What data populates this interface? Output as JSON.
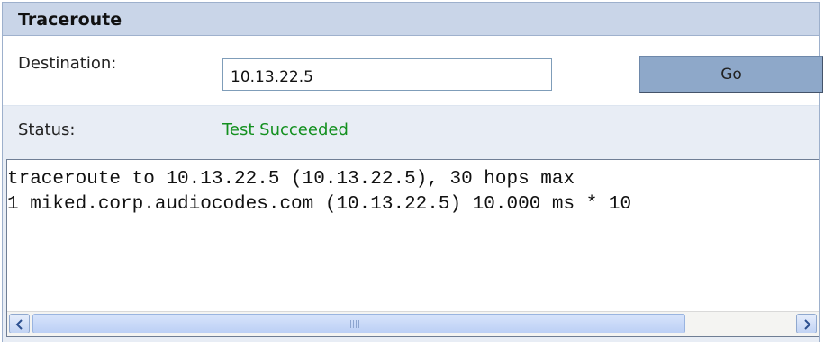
{
  "panel": {
    "title": "Traceroute"
  },
  "destination": {
    "label": "Destination:",
    "value": "10.13.22.5"
  },
  "go_button": {
    "label": "Go"
  },
  "status": {
    "label": "Status:",
    "value": "Test Succeeded",
    "color": "#13901f"
  },
  "output": {
    "lines": [
      "traceroute to 10.13.22.5 (10.13.22.5), 30 hops max",
      "1 miked.corp.audiocodes.com (10.13.22.5) 10.000 ms * 10"
    ]
  },
  "scrollbar": {
    "left_icon": "chevron-left-icon",
    "right_icon": "chevron-right-icon"
  }
}
